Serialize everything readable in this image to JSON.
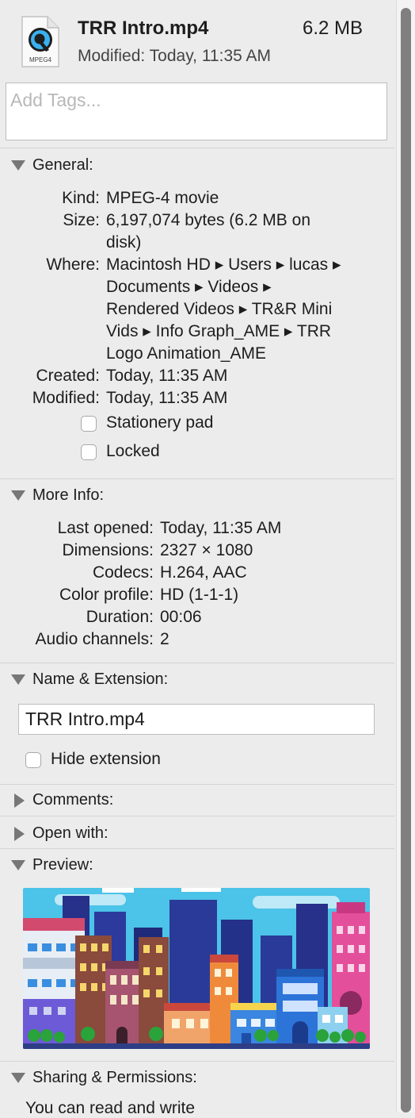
{
  "header": {
    "file_name": "TRR Intro.mp4",
    "file_size": "6.2 MB",
    "modified": "Modified: Today, 11:35 AM",
    "icon_label": "MPEG4"
  },
  "tags": {
    "placeholder": "Add Tags..."
  },
  "general": {
    "title": "General:",
    "rows": [
      {
        "label": "Kind:",
        "value": "MPEG-4 movie"
      },
      {
        "label": "Size:",
        "lines": [
          "6,197,074 bytes (6.2 MB on",
          "disk)"
        ]
      },
      {
        "label": "Where:",
        "lines": [
          "Macintosh HD ▸ Users ▸ lucas ▸",
          "Documents ▸ Videos ▸",
          "Rendered Videos ▸ TR&R Mini",
          "Vids ▸ Info Graph_AME ▸ TRR",
          "Logo Animation_AME"
        ]
      },
      {
        "label": "Created:",
        "value": "Today, 11:35 AM"
      },
      {
        "label": "Modified:",
        "value": "Today, 11:35 AM"
      }
    ],
    "stationery_pad": "Stationery pad",
    "locked": "Locked"
  },
  "more_info": {
    "title": "More Info:",
    "rows": [
      {
        "label": "Last opened:",
        "value": "Today, 11:35 AM"
      },
      {
        "label": "Dimensions:",
        "value": "2327 × 1080"
      },
      {
        "label": "Codecs:",
        "value": "H.264, AAC"
      },
      {
        "label": "Color profile:",
        "value": "HD (1-1-1)"
      },
      {
        "label": "Duration:",
        "value": "00:06"
      },
      {
        "label": "Audio channels:",
        "value": "2"
      }
    ]
  },
  "name_extension": {
    "title": "Name & Extension:",
    "value": "TRR Intro.mp4",
    "hide_extension": "Hide extension"
  },
  "comments": {
    "title": "Comments:"
  },
  "open_with": {
    "title": "Open with:"
  },
  "preview": {
    "title": "Preview:"
  },
  "sharing": {
    "title": "Sharing & Permissions:",
    "text": "You can read and write"
  },
  "colors": {
    "panel_bg": "#ececec",
    "separator": "#d3d3d3",
    "sky": "#4cc3e8",
    "skyline_dark": "#27318a",
    "tree_green": "#2aa33a"
  }
}
